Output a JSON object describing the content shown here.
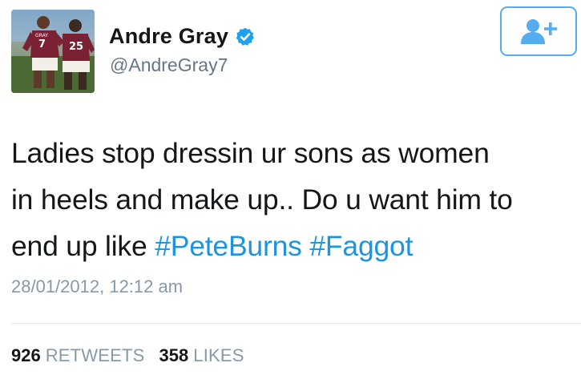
{
  "user": {
    "display_name": "Andre Gray",
    "handle": "@AndreGray7",
    "verified": true,
    "avatar_jersey_numbers": [
      "7",
      "25"
    ],
    "avatar_jersey_name": "GRAY"
  },
  "follow_button": {
    "icon": "add-user-icon"
  },
  "tweet": {
    "lines": [
      {
        "text": "Ladies stop dressin ur sons as women"
      },
      {
        "text": "in heels and make up.. Do u want him to"
      },
      {
        "text": "end up like ",
        "hashtags": [
          "#PeteBurns",
          "#Faggot"
        ]
      }
    ],
    "timestamp": "28/01/2012, 12:12 am"
  },
  "stats": {
    "retweets_count": "926",
    "retweets_label": "RETWEETS",
    "likes_count": "358",
    "likes_label": "LIKES"
  },
  "colors": {
    "accent": "#1da1f2",
    "hashtag": "#1b95e0",
    "muted_text": "#8899a6",
    "handle_text": "#657786",
    "primary_text": "#14171a",
    "divider": "#e1e8ed"
  }
}
